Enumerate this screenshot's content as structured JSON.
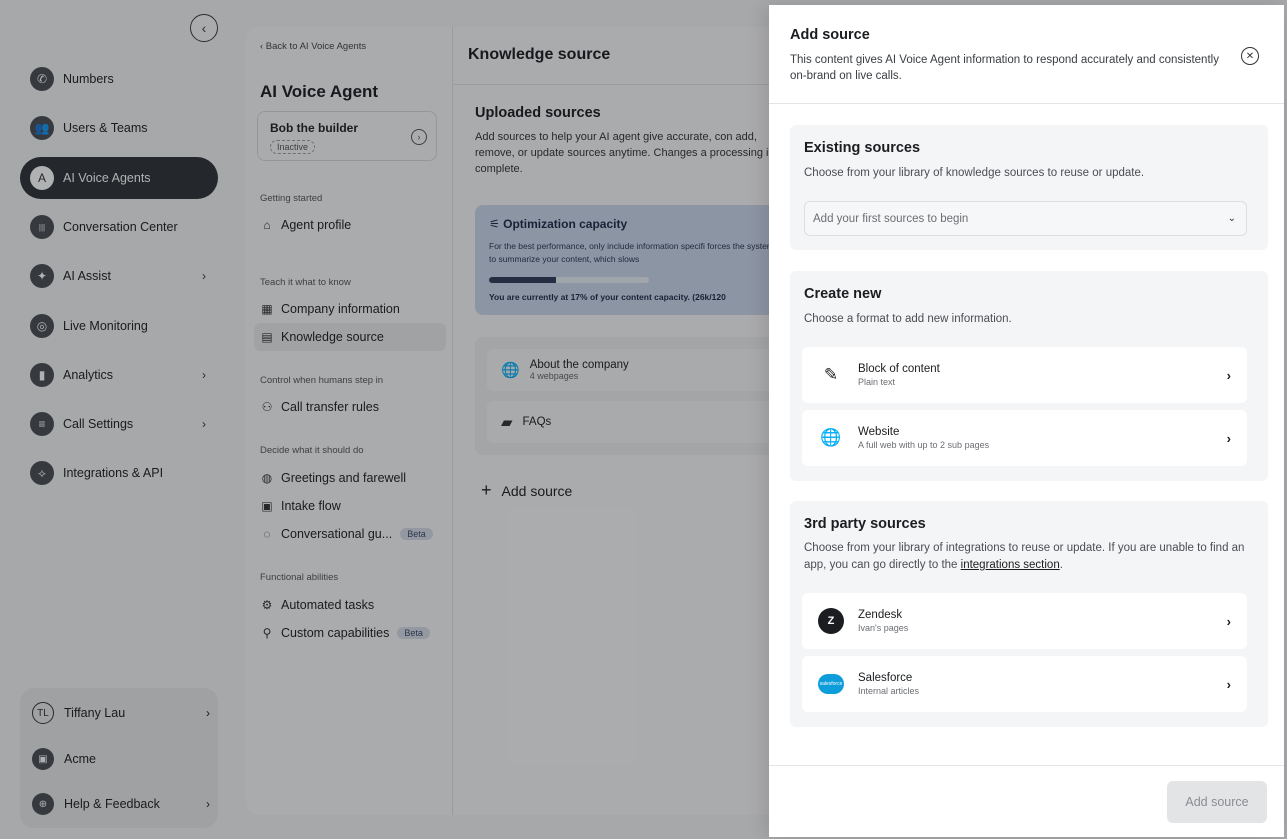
{
  "nav": {
    "items": [
      {
        "label": "Numbers",
        "icon": "phone-icon",
        "glyph": "✆",
        "chevron": ""
      },
      {
        "label": "Users & Teams",
        "icon": "users-icon",
        "glyph": "👥",
        "chevron": ""
      },
      {
        "label": "AI Voice Agents",
        "icon": "ai-agent-icon",
        "glyph": "A",
        "chevron": ""
      },
      {
        "label": "Conversation Center",
        "icon": "waveform-icon",
        "glyph": "|||",
        "chevron": ""
      },
      {
        "label": "AI Assist",
        "icon": "sparkle-icon",
        "glyph": "✦",
        "chevron": "›"
      },
      {
        "label": "Live Monitoring",
        "icon": "monitor-icon",
        "glyph": "◎",
        "chevron": ""
      },
      {
        "label": "Analytics",
        "icon": "bar-chart-icon",
        "glyph": "▮",
        "chevron": "›"
      },
      {
        "label": "Call Settings",
        "icon": "sliders-icon",
        "glyph": "≡",
        "chevron": "›"
      },
      {
        "label": "Integrations & API",
        "icon": "integrations-icon",
        "glyph": "⟡",
        "chevron": ""
      }
    ],
    "collapse_glyph": "‹",
    "bottom": [
      {
        "label": "Tiffany Lau",
        "icon": "TL",
        "chevron": "›"
      },
      {
        "label": "Acme",
        "icon": "▣",
        "chevron": ""
      },
      {
        "label": "Help & Feedback",
        "icon": "⊕",
        "chevron": "›"
      }
    ]
  },
  "subnav": {
    "back": "‹ Back to AI Voice Agents",
    "title": "AI Voice Agent",
    "agent_name": "Bob the builder",
    "agent_status": "Inactive",
    "agent_go": "›",
    "sections": {
      "getting_started": "Getting started",
      "teach": "Teach it what to know",
      "control": "Control when humans step in",
      "decide": "Decide what it should do",
      "functional": "Functional abilities"
    },
    "items": {
      "agent_profile": {
        "label": "Agent profile",
        "glyph": "⌂"
      },
      "company_info": {
        "label": "Company information",
        "glyph": "▦"
      },
      "knowledge_source": {
        "label": "Knowledge source",
        "glyph": "▤"
      },
      "call_transfer": {
        "label": "Call transfer rules",
        "glyph": "⚇"
      },
      "greetings": {
        "label": "Greetings and farewell",
        "glyph": "◍"
      },
      "intake": {
        "label": "Intake flow",
        "glyph": "▣"
      },
      "conversational": {
        "label": "Conversational gu...",
        "glyph": "◌",
        "badge": "Beta"
      },
      "automated": {
        "label": "Automated tasks",
        "glyph": "⚙"
      },
      "custom": {
        "label": "Custom capabilities",
        "glyph": "⚲",
        "badge": "Beta"
      }
    }
  },
  "main": {
    "title": "Knowledge source",
    "uploaded_title": "Uploaded sources",
    "uploaded_desc": "Add sources to help your AI agent give accurate, con add, remove, or update sources anytime. Changes a processing is complete.",
    "capacity_title": "Optimization capacity",
    "capacity_glyph": "⚟",
    "capacity_desc": "For the best performance, only include information specifi forces the system to summarize your content, which slows",
    "capacity_pct": 0.42,
    "capacity_status": "You are currently at 17% of your content capacity. (26k/120",
    "sources": [
      {
        "name": "About the company",
        "sub": "4 webpages",
        "glyph": "🌐"
      },
      {
        "name": "FAQs",
        "sub": "",
        "glyph": "▰"
      }
    ],
    "add_source_plus": "+",
    "add_source": "Add source"
  },
  "drawer": {
    "title": "Add source",
    "description": "This content gives AI Voice Agent information to respond accurately and consistently on-brand on live calls.",
    "close_glyph": "✕",
    "existing": {
      "title": "Existing sources",
      "description": "Choose from your library of knowledge sources to reuse or update.",
      "placeholder": "Add your first sources to begin",
      "caret": "⌄"
    },
    "create": {
      "title": "Create new",
      "description": "Choose a format to add new information.",
      "options": [
        {
          "name": "Block of content",
          "sub": "Plain text",
          "glyph": "✎",
          "chevron": "›"
        },
        {
          "name": "Website",
          "sub": "A full web with up to 2 sub pages",
          "glyph": "🌐",
          "chevron": "›"
        }
      ]
    },
    "third_party": {
      "title": "3rd party sources",
      "description_pre": "Choose from your library of integrations to reuse or update. If you are unable to find an app, you can go directly to the ",
      "link": "integrations section",
      "description_post": ".",
      "options": [
        {
          "name": "Zendesk",
          "sub": "Ivan's pages",
          "glyph": "Z",
          "chevron": "›"
        },
        {
          "name": "Salesforce",
          "sub": "Internal articles",
          "glyph": "salesforce",
          "chevron": "›"
        }
      ]
    },
    "submit": "Add source"
  }
}
